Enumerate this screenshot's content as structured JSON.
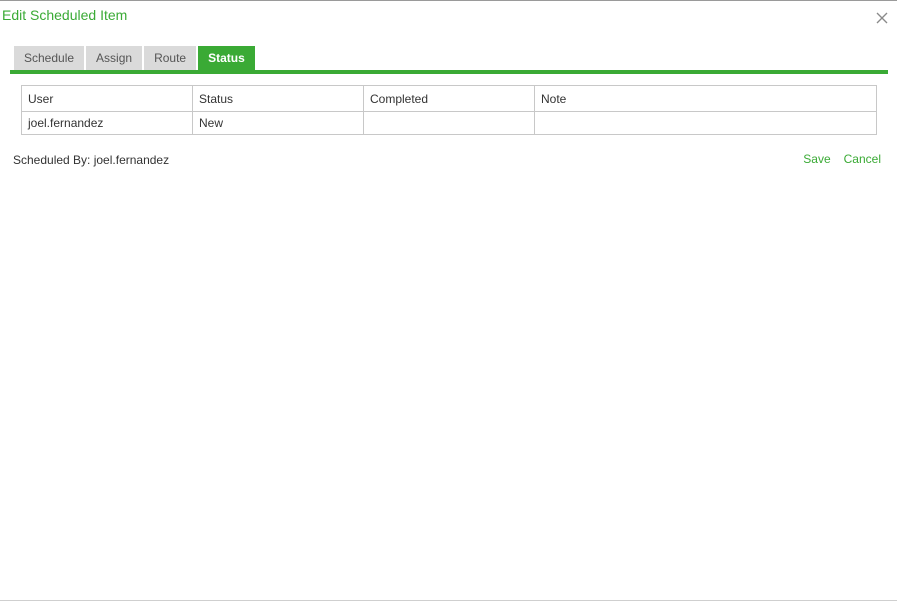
{
  "dialog": {
    "title": "Edit Scheduled Item",
    "close_icon": "close-icon"
  },
  "tabs": [
    {
      "label": "Schedule",
      "active": false
    },
    {
      "label": "Assign",
      "active": false
    },
    {
      "label": "Route",
      "active": false
    },
    {
      "label": "Status",
      "active": true
    }
  ],
  "table": {
    "headers": [
      "User",
      "Status",
      "Completed",
      "Note"
    ],
    "rows": [
      [
        "joel.fernandez",
        "New",
        "",
        ""
      ]
    ]
  },
  "footer": {
    "scheduled_by": "Scheduled By: joel.fernandez",
    "save_label": "Save",
    "cancel_label": "Cancel"
  },
  "colors": {
    "accent": "#3aaa35",
    "tab_inactive": "#dadada"
  }
}
